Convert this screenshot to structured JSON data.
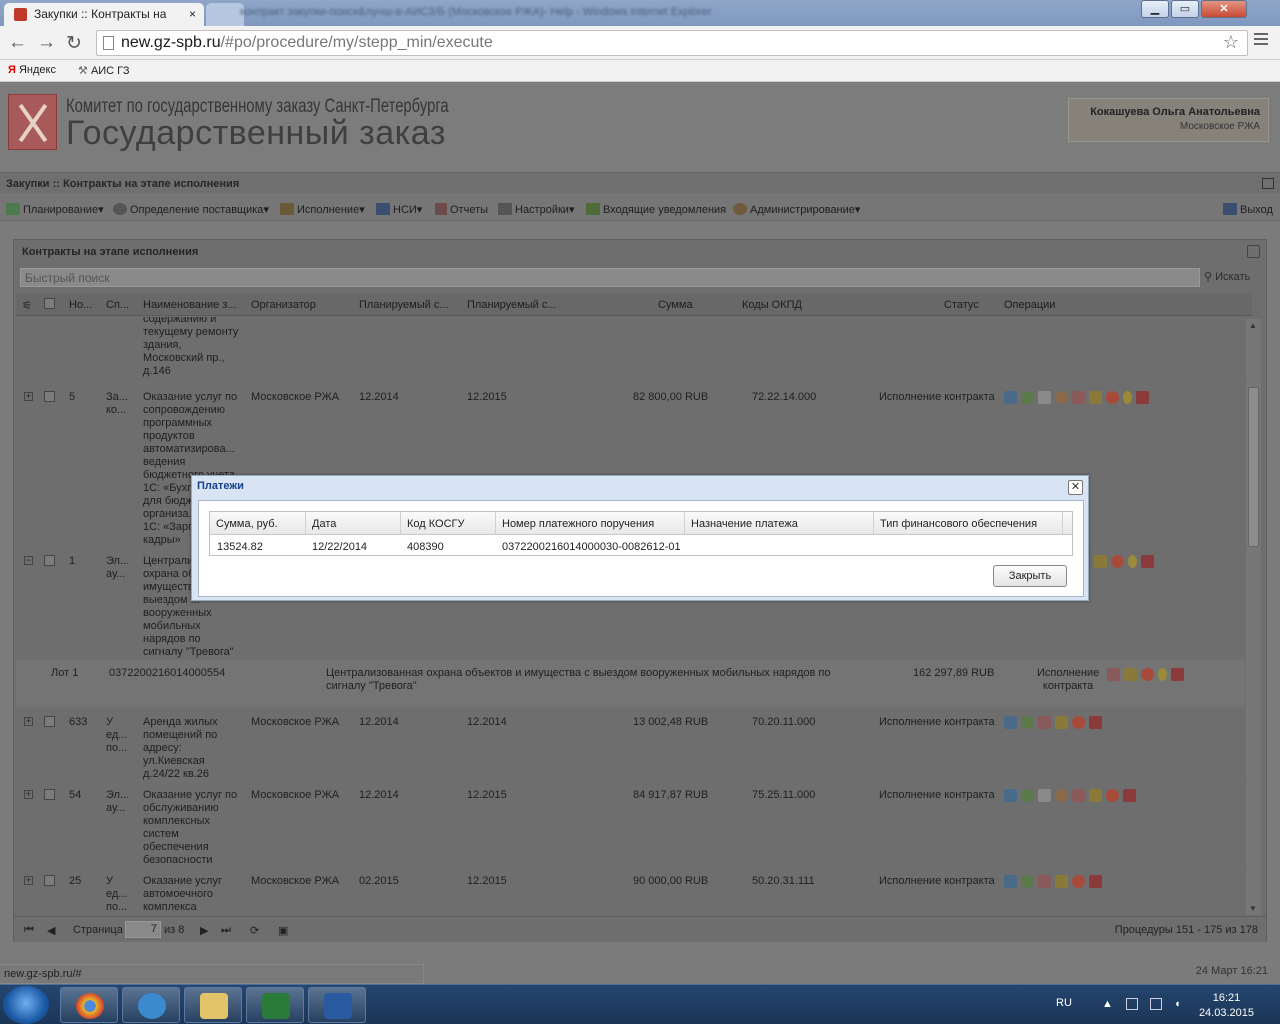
{
  "browser": {
    "tab_title": "Закупки :: Контракты на",
    "tab_close": "×",
    "url_host": "new.gz-spb.ru",
    "url_path": "/#po/procedure/my/stepp_min/execute",
    "other_window_title": "контракт закупки-поиск&лучш-в-АИСЗ/Б (Московское РЖА)- Help - Windows Internet Explorer",
    "bookmarks": [
      "Яндекс",
      "АИС ГЗ"
    ]
  },
  "site": {
    "title_line1": "Комитет по государственному заказу Санкт-Петербурга",
    "title_line2": "Государственный заказ",
    "user_name": "Кокашуева Ольга Анатольевна",
    "user_org": "Московское РЖА"
  },
  "section_bar": "Закупки :: Контракты на этапе исполнения",
  "menu": {
    "items": [
      "Планирование",
      "Определение поставщика",
      "Исполнение",
      "НСИ",
      "Отчеты",
      "Настройки",
      "Входящие уведомления",
      "Администрирование"
    ],
    "logout": "Выход"
  },
  "panel": {
    "title": "Контракты на этапе исполнения",
    "search_placeholder": "Быстрый поиск",
    "search_button": "Искать",
    "columns": [
      "Но...",
      "Сп...",
      "Наименование з...",
      "Организатор",
      "Планируемый с...",
      "Планируемый с...",
      "Сумма",
      "Коды ОКПД",
      "Статус",
      "Операции"
    ]
  },
  "rows": [
    {
      "name": "содержанию и\nтекущему ремонту\nздания,\nМосковский пр.,\nд.146"
    },
    {
      "num": "5",
      "sp": "За...\nко...",
      "name": "Оказание услуг по\nсопровождению\nпрограммных\nпродуктов\nавтоматизирова...\nведения\nбюджетного учета\n1С: «Бухг...\nдля бюдж...\nорганиза...\n1С: «Зарп...\nкадры»",
      "org": "Московское РЖА",
      "p1": "12.2014",
      "p2": "12.2015",
      "sum": "82 800,00 RUB",
      "okpd": "72.22.14.000",
      "status": "Исполнение контракта"
    },
    {
      "num": "1",
      "sp": "Эл...\nау...",
      "name": "Централи...\nохрана об...\nимуществ...\nвыездом ...\nвооруженных\nмобильных\nнарядов по\nсигналу \"Тревога\""
    },
    {
      "num": "633",
      "sp": "У\nед...\nпо...",
      "name": "Аренда жилых\nпомещений по\nадресу:\nул.Киевская\nд.24/22 кв.26",
      "org": "Московское РЖА",
      "p1": "12.2014",
      "p2": "12.2014",
      "sum": "13 002,48 RUB",
      "okpd": "70.20.11.000",
      "status": "Исполнение контракта"
    },
    {
      "num": "54",
      "sp": "Эл...\nау...",
      "name": "Оказание услуг по\nобслуживанию\nкомплексных\nсистем\nобеспечения\nбезопасности",
      "org": "Московское РЖА",
      "p1": "12.2014",
      "p2": "12.2015",
      "sum": "84 917,87 RUB",
      "okpd": "75.25.11.000",
      "status": "Исполнение контракта"
    },
    {
      "num": "25",
      "sp": "У\nед...\nпо...",
      "name": "Оказание услуг\nавтомоечного\nкомплекса",
      "org": "Московское РЖА",
      "p1": "02.2015",
      "p2": "12.2015",
      "sum": "90 000,00 RUB",
      "okpd": "50.20.31.111",
      "status": "Исполнение контракта"
    }
  ],
  "lot": {
    "label": "Лот 1",
    "number": "0372200216014000554",
    "description": "Централизованная охрана объектов и имущества с выездом вооруженных мобильных нарядов по сигналу \"Тревога\"",
    "sum": "162 297,89 RUB",
    "status": "Исполнение\nконтракта"
  },
  "pager": {
    "page_label": "Страница",
    "page_value": "7",
    "of_label": "из 8",
    "range_text": "Процедуры 151 - 175 из 178"
  },
  "dialog": {
    "title": "Платежи",
    "columns": [
      "Сумма, руб.",
      "Дата",
      "Код КОСГУ",
      "Номер платежного поручения",
      "Назначение платежа",
      "Тип финансового обеспечения"
    ],
    "row": [
      "13524.82",
      "12/22/2014",
      "408390",
      "0372200216014000030-0082612-01",
      "",
      ""
    ],
    "close_label": "Закрыть"
  },
  "statusbar": {
    "url": "new.gz-spb.ru/#",
    "datetime": "24 Март 16:21"
  },
  "taskbar": {
    "lang": "RU",
    "time": "16:21",
    "date": "24.03.2015"
  },
  "colors": {
    "dialog_title": "#15428b",
    "overlay_gray": "#7b7b7b",
    "taskbar": "#1b3557"
  }
}
